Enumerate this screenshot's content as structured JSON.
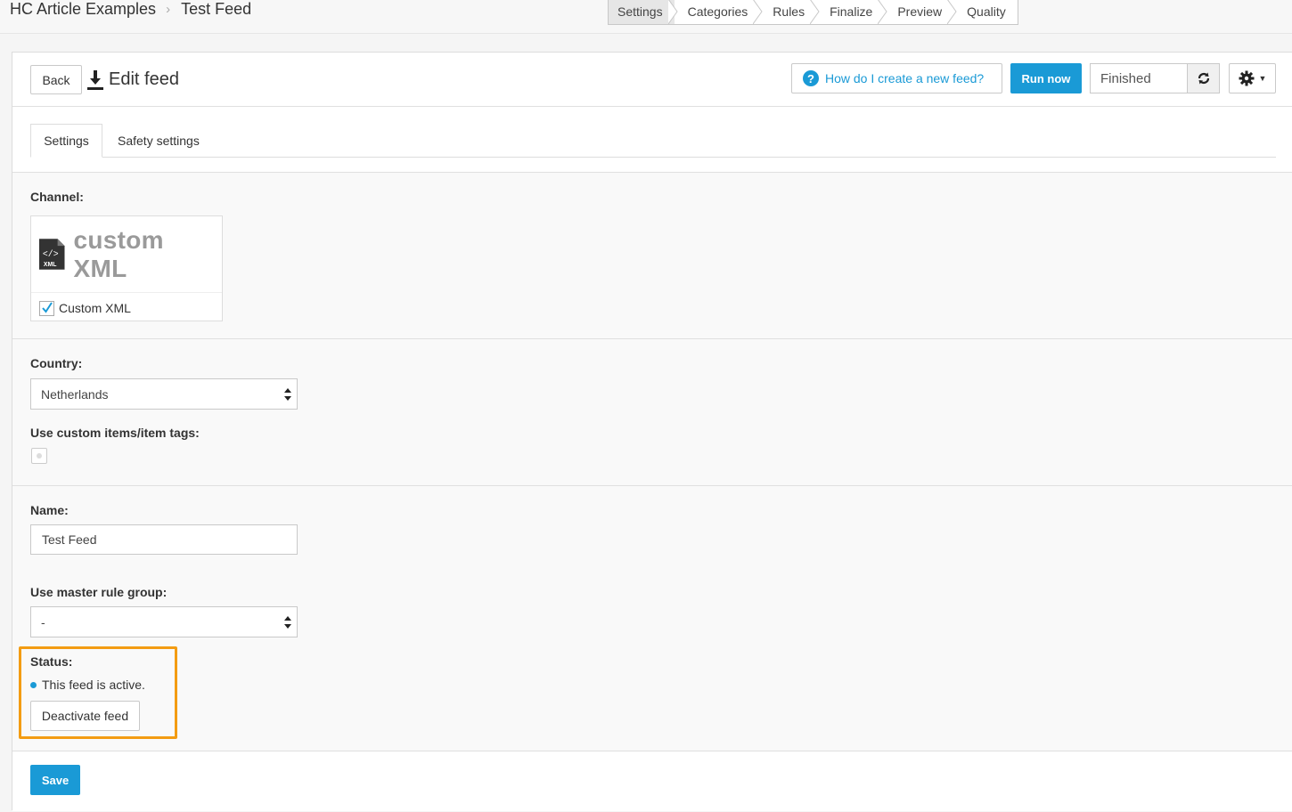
{
  "breadcrumb": {
    "account": "HC Article Examples",
    "current": "Test Feed"
  },
  "steps": [
    "Settings",
    "Categories",
    "Rules",
    "Finalize",
    "Preview",
    "Quality"
  ],
  "header": {
    "back_label": "Back",
    "title": "Edit feed",
    "help_label": "How do I create a new feed?",
    "run_label": "Run now",
    "status_value": "Finished"
  },
  "tabs": [
    "Settings",
    "Safety settings"
  ],
  "channel": {
    "label": "Channel:",
    "logo_text": "custom XML",
    "checkbox_label": "Custom XML"
  },
  "country": {
    "label": "Country:",
    "value": "Netherlands"
  },
  "custom_items": {
    "label": "Use custom items/item tags:"
  },
  "name": {
    "label": "Name:",
    "value": "Test Feed"
  },
  "master_rule": {
    "label": "Use master rule group:",
    "value": "-"
  },
  "status": {
    "label": "Status:",
    "text": "This feed is active.",
    "deactivate_label": "Deactivate feed"
  },
  "save_label": "Save",
  "colors": {
    "accent": "#1a9ad6",
    "highlight": "#f39c12"
  }
}
